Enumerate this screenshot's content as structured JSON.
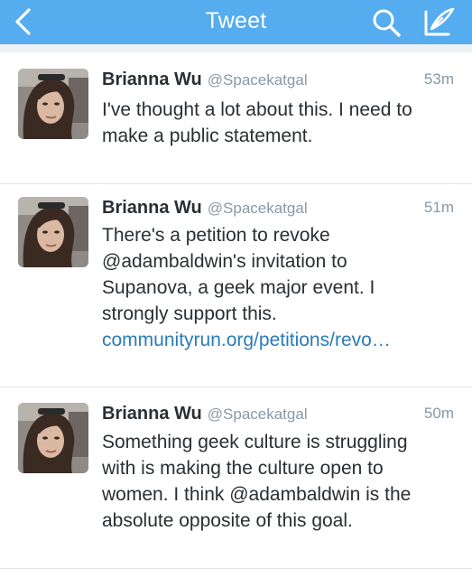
{
  "header": {
    "title": "Tweet",
    "back_icon": "chevron-left-icon",
    "search_icon": "search-icon",
    "compose_icon": "compose-icon",
    "bar_color": "#55acee"
  },
  "tweets": [
    {
      "name": "Brianna Wu",
      "handle": "@Spacekatgal",
      "time": "53m",
      "lines": [
        "I've thought a lot about this. I need to",
        "make a public statement."
      ]
    },
    {
      "name": "Brianna Wu",
      "handle": "@Spacekatgal",
      "time": "51m",
      "lines": [
        "There's a petition to revoke",
        "@adambaldwin's invitation to",
        "Supanova, a geek major event. I",
        "strongly support this."
      ],
      "link": "communityrun.org/petitions/revo…"
    },
    {
      "name": "Brianna Wu",
      "handle": "@Spacekatgal",
      "time": "50m",
      "lines": [
        "Something geek culture is struggling",
        "with is making the culture open to",
        "women. I think @adambaldwin is the",
        "absolute opposite of this goal."
      ]
    }
  ],
  "colors": {
    "name": "#292f33",
    "meta": "#8899a6",
    "link": "#2b7bb9"
  }
}
